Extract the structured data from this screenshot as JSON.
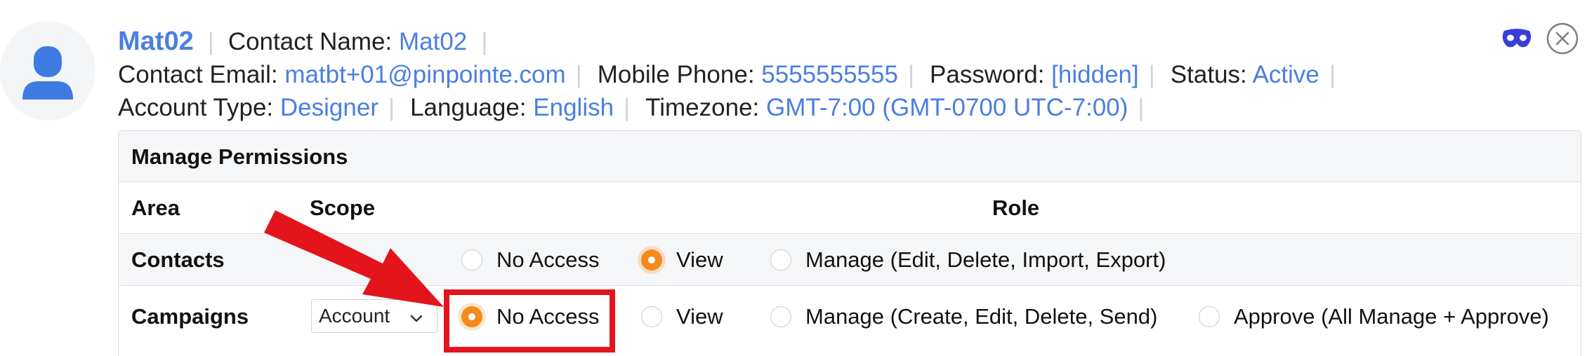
{
  "contact": {
    "name": "Mat02",
    "contact_name_label": "Contact Name:",
    "contact_name_value": "Mat02",
    "email_label": "Contact Email:",
    "email_value": "matbt+01@pinpointe.com",
    "mobile_label": "Mobile Phone:",
    "mobile_value": "5555555555",
    "password_label": "Password:",
    "password_value": "[hidden]",
    "status_label": "Status:",
    "status_value": "Active",
    "account_type_label": "Account Type:",
    "account_type_value": "Designer",
    "language_label": "Language:",
    "language_value": "English",
    "timezone_label": "Timezone:",
    "timezone_value": "GMT-7:00 (GMT-0700 UTC-7:00)",
    "separator": "|"
  },
  "icons": {
    "avatar": "person-icon",
    "mask": "mask-icon",
    "close": "close-icon"
  },
  "permissions": {
    "title": "Manage Permissions",
    "headers": {
      "area": "Area",
      "scope": "Scope",
      "role": "Role"
    },
    "rows": [
      {
        "area": "Contacts",
        "scope": "",
        "options": [
          {
            "label": "No Access",
            "selected": false
          },
          {
            "label": "View",
            "selected": true
          },
          {
            "label": "Manage (Edit, Delete, Import, Export)",
            "selected": false
          }
        ]
      },
      {
        "area": "Campaigns",
        "scope": "Account",
        "options": [
          {
            "label": "No Access",
            "selected": true
          },
          {
            "label": "View",
            "selected": false
          },
          {
            "label": "Manage (Create, Edit, Delete, Send)",
            "selected": false
          },
          {
            "label": "Approve (All Manage + Approve)",
            "selected": false
          }
        ]
      }
    ]
  },
  "colors": {
    "link": "#4a7fe0",
    "radio_selected": "#f48a1b",
    "annotation": "#e3141b",
    "mask_icon": "#3b3fd8"
  }
}
